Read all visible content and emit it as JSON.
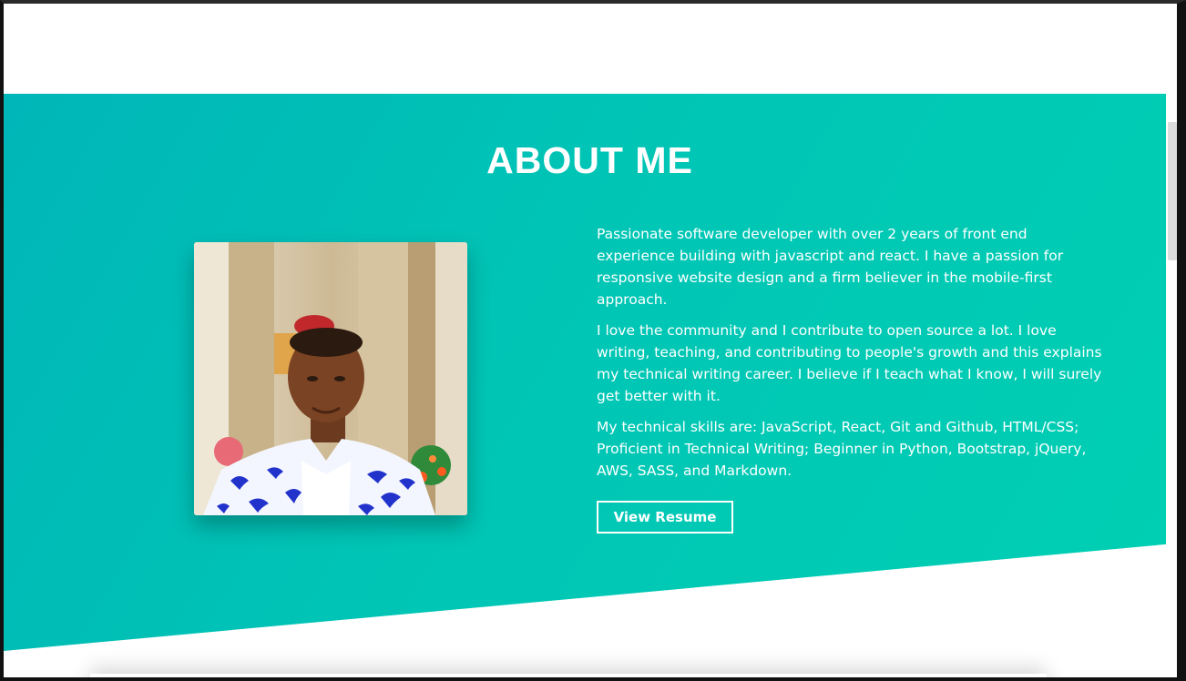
{
  "about": {
    "heading": "ABOUT ME",
    "photo_alt": "Profile photo",
    "paragraphs": [
      "Passionate software developer with over 2 years of front end experience building with javascript and react. I have a passion for responsive website design and a firm believer in the mobile-first approach.",
      "I love the community and I contribute to open source a lot. I love writing, teaching, and contributing to people's growth and this explains my technical writing career. I believe if I teach what I know, I will surely get better with it.",
      "My technical skills are: JavaScript, React, Git and Github, HTML/CSS; Proficient in Technical Writing; Beginner in Python, Bootstrap, jQuery, AWS, SASS, and Markdown."
    ],
    "resume_button": "View Resume"
  },
  "colors": {
    "gradient_start": "#00b6b8",
    "gradient_end": "#00d0b3",
    "text": "#ffffff"
  }
}
